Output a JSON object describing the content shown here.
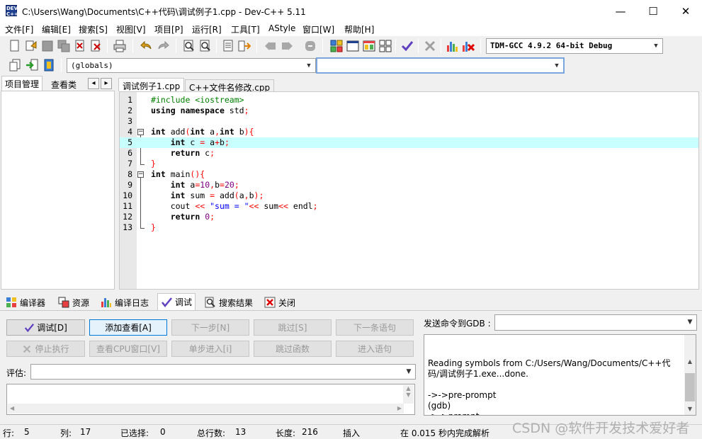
{
  "window": {
    "title": "C:\\Users\\Wang\\Documents\\C++代码\\调试例子1.cpp - Dev-C++ 5.11",
    "app_icon_text": "DEV C++",
    "minimize_glyph": "—",
    "maximize_glyph": "☐",
    "close_glyph": "✕"
  },
  "menu": [
    "文件[F]",
    "编辑[E]",
    "搜索[S]",
    "视图[V]",
    "项目[P]",
    "运行[R]",
    "工具[T]",
    "AStyle",
    "窗口[W]",
    "帮助[H]"
  ],
  "toolbar": {
    "compiler_select": "TDM-GCC 4.9.2 64-bit Debug",
    "scope_select": "(globals)",
    "function_select": ""
  },
  "left_panel": {
    "tabs": [
      "项目管理",
      "查看类"
    ],
    "nav_prev": "◂",
    "nav_next": "▸"
  },
  "editor": {
    "tabs": [
      "调试例子1.cpp",
      "C++文件名修改.cpp"
    ],
    "active_tab": 0,
    "highlighted_line": 5,
    "lines": [
      {
        "n": "1",
        "text": "#include <iostream>"
      },
      {
        "n": "2",
        "text": "using namespace std;"
      },
      {
        "n": "3",
        "text": ""
      },
      {
        "n": "4",
        "text": "int add(int a,int b){"
      },
      {
        "n": "5",
        "text": "    int c = a+b;"
      },
      {
        "n": "6",
        "text": "    return c;"
      },
      {
        "n": "7",
        "text": "}"
      },
      {
        "n": "8",
        "text": "int main(){"
      },
      {
        "n": "9",
        "text": "    int a=10,b=20;"
      },
      {
        "n": "10",
        "text": "    int sum = add(a,b);"
      },
      {
        "n": "11",
        "text": "    cout << \"sum = \"<< sum<< endl;"
      },
      {
        "n": "12",
        "text": "    return 0;"
      },
      {
        "n": "13",
        "text": "}"
      }
    ]
  },
  "bottom_tabs": [
    {
      "label": "编译器",
      "icon": "grid-icon"
    },
    {
      "label": "资源",
      "icon": "resource-icon"
    },
    {
      "label": "编译日志",
      "icon": "chart-icon"
    },
    {
      "label": "调试",
      "icon": "check-icon",
      "active": true
    },
    {
      "label": "搜索结果",
      "icon": "search-icon"
    },
    {
      "label": "关闭",
      "icon": "close-icon"
    }
  ],
  "debug": {
    "buttons_row1": [
      {
        "label": "调试[D]",
        "enabled": true
      },
      {
        "label": "添加查看[A]",
        "enabled": true
      },
      {
        "label": "下一步[N]",
        "enabled": false
      },
      {
        "label": "跳过[S]",
        "enabled": false
      },
      {
        "label": "下一条语句",
        "enabled": false
      }
    ],
    "buttons_row2": [
      {
        "label": "停止执行",
        "enabled": false
      },
      {
        "label": "查看CPU窗口[V]",
        "enabled": false
      },
      {
        "label": "单步进入[i]",
        "enabled": false
      },
      {
        "label": "跳过函数",
        "enabled": false
      },
      {
        "label": "进入语句",
        "enabled": false
      }
    ],
    "evaluate_label": "评估:",
    "evaluate_value": "",
    "gdb_label": "发送命令到GDB :",
    "gdb_command": "",
    "gdb_output": "Reading symbols from C:/Users/Wang/Documents/C++代码/调试例子1.exe...done.\n\n->->pre-prompt\n(gdb)\n->->prompt"
  },
  "status": {
    "row_label": "行:",
    "row": "5",
    "col_label": "列:",
    "col": "17",
    "sel_label": "已选择:",
    "sel": "0",
    "total_label": "总行数:",
    "total": "13",
    "len_label": "长度:",
    "len": "216",
    "mode": "插入",
    "parse": "在 0.015 秒内完成解析"
  },
  "watermark": "CSDN @软件开发技术爱好者",
  "colors": {
    "line_highlight": "#c8ffff",
    "keyword": "#000000",
    "preprocessor": "#008000",
    "symbol": "#ff0000",
    "number": "#800080",
    "string": "#0000ff"
  }
}
